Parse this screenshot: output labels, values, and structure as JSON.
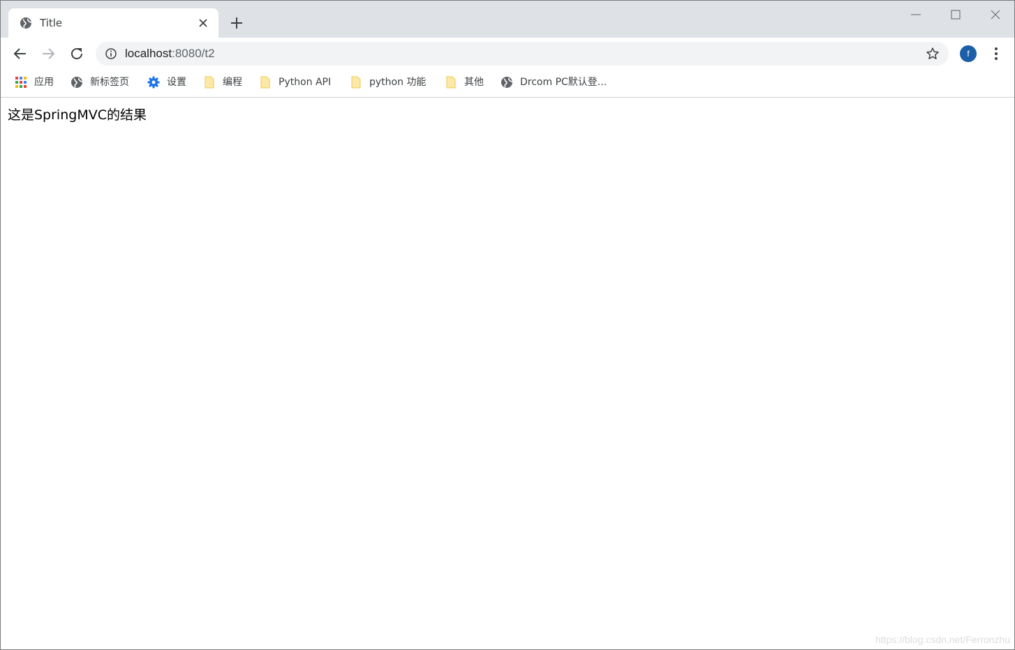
{
  "tab": {
    "title": "Title",
    "favicon": "globe-icon"
  },
  "toolbar": {
    "url_host": "localhost",
    "url_rest": ":8080/t2",
    "avatar_letter": "f",
    "avatar_color": "#1a5fa8"
  },
  "bookmarks": [
    {
      "label": "应用",
      "icon": "apps-grid-icon"
    },
    {
      "label": "新标签页",
      "icon": "globe-icon"
    },
    {
      "label": "设置",
      "icon": "gear-icon"
    },
    {
      "label": "编程",
      "icon": "folder-icon"
    },
    {
      "label": "Python API",
      "icon": "folder-icon"
    },
    {
      "label": "python 功能",
      "icon": "folder-icon"
    },
    {
      "label": "其他",
      "icon": "folder-icon"
    },
    {
      "label": "Drcom PC默认登...",
      "icon": "globe-icon"
    }
  ],
  "page": {
    "text": "这是SpringMVC的结果"
  },
  "watermark": "https://blog.csdn.net/Ferronzhu"
}
